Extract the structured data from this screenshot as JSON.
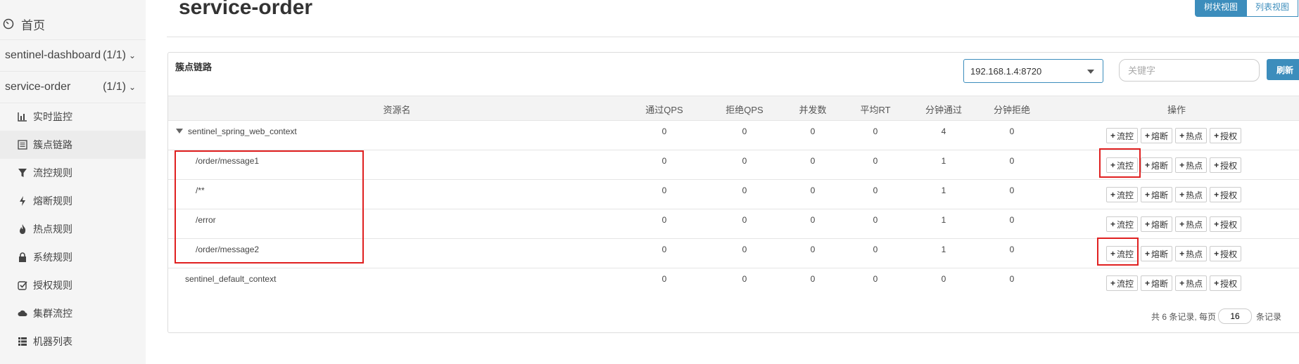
{
  "sidebar": {
    "home_label": "首页",
    "apps": [
      {
        "name": "sentinel-dashboard",
        "count": "(1/1)"
      },
      {
        "name": "service-order",
        "count": "(1/1)"
      }
    ],
    "items": [
      {
        "label": "实时监控",
        "icon": "bar-chart-icon"
      },
      {
        "label": "簇点链路",
        "icon": "list-icon"
      },
      {
        "label": "流控规则",
        "icon": "filter-icon"
      },
      {
        "label": "熔断规则",
        "icon": "flash-icon"
      },
      {
        "label": "热点规则",
        "icon": "fire-icon"
      },
      {
        "label": "系统规则",
        "icon": "lock-icon"
      },
      {
        "label": "授权规则",
        "icon": "check-square-icon"
      },
      {
        "label": "集群流控",
        "icon": "cloud-icon"
      },
      {
        "label": "机器列表",
        "icon": "th-list-icon"
      }
    ]
  },
  "header": {
    "title": "service-order",
    "views": [
      "树状视图",
      "列表视图"
    ],
    "active_view": "树状视图"
  },
  "panel": {
    "title": "簇点链路",
    "machine": "192.168.1.4:8720",
    "search_placeholder": "关键字",
    "refresh_label": "刷新"
  },
  "table": {
    "columns": [
      "资源名",
      "通过QPS",
      "拒绝QPS",
      "并发数",
      "平均RT",
      "分钟通过",
      "分钟拒绝",
      "操作"
    ],
    "rows": [
      {
        "name": "sentinel_spring_web_context",
        "pass_qps": "0",
        "block_qps": "0",
        "threads": "0",
        "avg_rt": "0",
        "minute_pass": "4",
        "minute_block": "0"
      },
      {
        "name": "/order/message1",
        "pass_qps": "0",
        "block_qps": "0",
        "threads": "0",
        "avg_rt": "0",
        "minute_pass": "1",
        "minute_block": "0"
      },
      {
        "name": "/**",
        "pass_qps": "0",
        "block_qps": "0",
        "threads": "0",
        "avg_rt": "0",
        "minute_pass": "1",
        "minute_block": "0"
      },
      {
        "name": "/error",
        "pass_qps": "0",
        "block_qps": "0",
        "threads": "0",
        "avg_rt": "0",
        "minute_pass": "1",
        "minute_block": "0"
      },
      {
        "name": "/order/message2",
        "pass_qps": "0",
        "block_qps": "0",
        "threads": "0",
        "avg_rt": "0",
        "minute_pass": "1",
        "minute_block": "0"
      },
      {
        "name": "sentinel_default_context",
        "pass_qps": "0",
        "block_qps": "0",
        "threads": "0",
        "avg_rt": "0",
        "minute_pass": "0",
        "minute_block": "0"
      }
    ],
    "actions": [
      "流控",
      "熔断",
      "热点",
      "授权"
    ]
  },
  "pagination": {
    "summary": "共 6 条记录, 每页",
    "page_size": "16",
    "suffix": "条记录"
  },
  "colors": {
    "accent": "#3c8dbc",
    "highlight": "#e02020"
  }
}
